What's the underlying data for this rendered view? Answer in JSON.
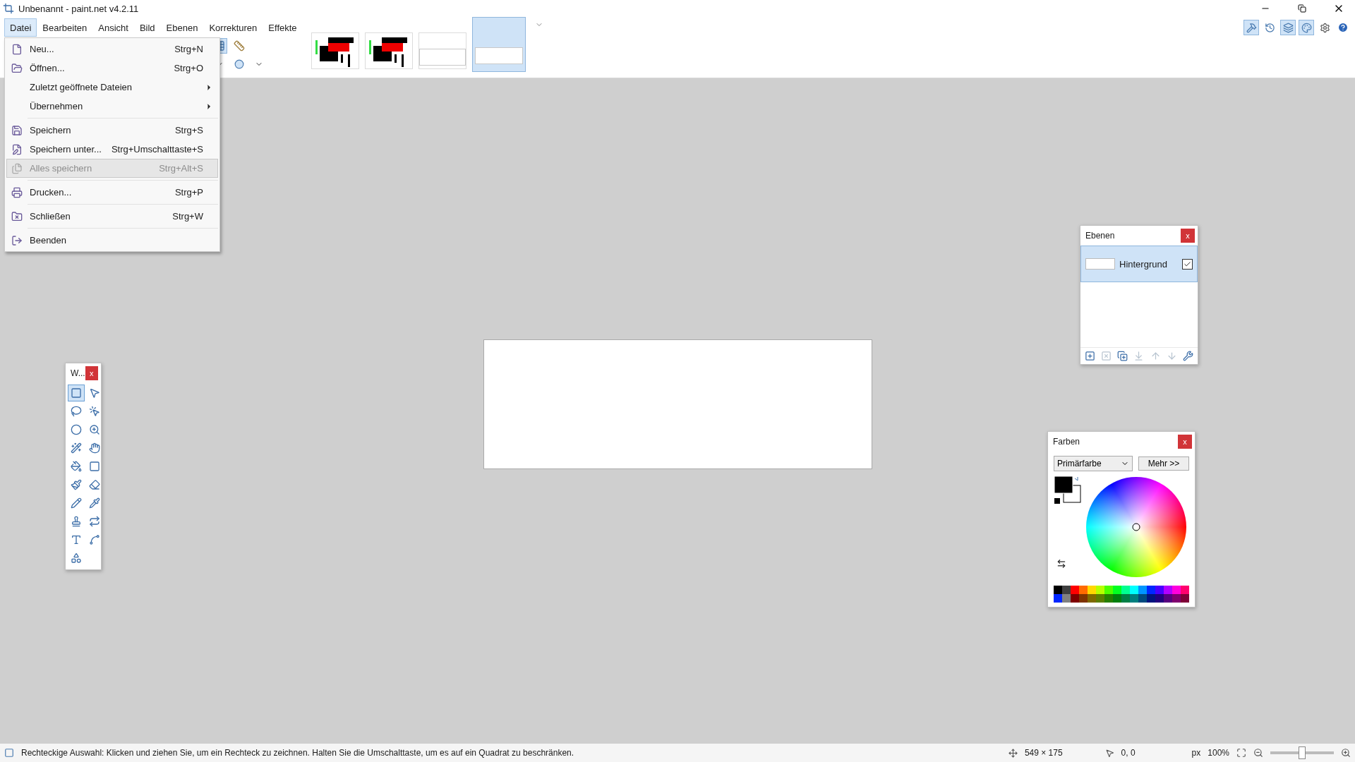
{
  "window": {
    "title": "Unbenannt - paint.net v4.2.11"
  },
  "menu_bar": [
    {
      "label": "Datei",
      "selected": true
    },
    {
      "label": "Bearbeiten",
      "selected": false
    },
    {
      "label": "Ansicht",
      "selected": false
    },
    {
      "label": "Bild",
      "selected": false
    },
    {
      "label": "Ebenen",
      "selected": false
    },
    {
      "label": "Korrekturen",
      "selected": false
    },
    {
      "label": "Effekte",
      "selected": false
    }
  ],
  "image_tabs": [
    {
      "kind": "picture",
      "selected": false
    },
    {
      "kind": "picture",
      "selected": false
    },
    {
      "kind": "blank",
      "selected": false
    },
    {
      "kind": "blank",
      "selected": true
    }
  ],
  "panel_toggles": [
    {
      "selected": true
    },
    {
      "selected": false
    },
    {
      "selected": true
    },
    {
      "selected": true
    }
  ],
  "file_menu": [
    [
      {
        "label": "Neu...",
        "shortcut": "Strg+N",
        "kind": "command",
        "disabled": false,
        "selected": false
      },
      {
        "label": "Öffnen...",
        "shortcut": "Strg+O",
        "kind": "command",
        "disabled": false,
        "selected": false
      },
      {
        "label": "Zuletzt geöffnete Dateien",
        "kind": "submenu",
        "disabled": false,
        "selected": false
      },
      {
        "label": "Übernehmen",
        "kind": "submenu",
        "disabled": false,
        "selected": false
      }
    ],
    [
      {
        "label": "Speichern",
        "shortcut": "Strg+S",
        "kind": "command",
        "disabled": false,
        "selected": false
      },
      {
        "label": "Speichern unter...",
        "shortcut": "Strg+Umschalttaste+S",
        "kind": "command",
        "disabled": false,
        "selected": false
      },
      {
        "label": "Alles speichern",
        "shortcut": "Strg+Alt+S",
        "kind": "command",
        "disabled": true,
        "selected": true
      }
    ],
    [
      {
        "label": "Drucken...",
        "shortcut": "Strg+P",
        "kind": "command",
        "disabled": false,
        "selected": false
      }
    ],
    [
      {
        "label": "Schließen",
        "shortcut": "Strg+W",
        "kind": "command",
        "disabled": false,
        "selected": false
      }
    ],
    [
      {
        "label": "Beenden",
        "kind": "command",
        "disabled": false,
        "selected": false
      }
    ]
  ],
  "tools_window": {
    "title": "W...",
    "close": "x",
    "tools": [
      {
        "selected": true
      },
      {
        "selected": false
      },
      {
        "selected": false
      },
      {
        "selected": false
      },
      {
        "selected": false
      },
      {
        "selected": false
      },
      {
        "selected": false
      },
      {
        "selected": false
      },
      {
        "selected": false
      },
      {
        "selected": false
      },
      {
        "selected": false
      },
      {
        "selected": false
      },
      {
        "selected": false
      },
      {
        "selected": false
      },
      {
        "selected": false
      },
      {
        "selected": false
      },
      {
        "selected": false
      },
      {
        "selected": false
      },
      {
        "selected": false
      }
    ]
  },
  "layers_window": {
    "title": "Ebenen",
    "close": "x",
    "layers": [
      {
        "name": "Hintergrund",
        "visible": true,
        "selected": true
      }
    ],
    "buttons": [
      {
        "disabled": false
      },
      {
        "disabled": true
      },
      {
        "disabled": false
      },
      {
        "disabled": true
      },
      {
        "disabled": true
      },
      {
        "disabled": true
      },
      {
        "disabled": false
      }
    ]
  },
  "colors_window": {
    "title": "Farben",
    "close": "x",
    "target": "Primärfarbe",
    "more_button": "Mehr >>",
    "palette": [
      {
        "color": "#000000"
      },
      {
        "color": "#404040"
      },
      {
        "color": "#ff0000"
      },
      {
        "color": "#ff6a00"
      },
      {
        "color": "#ffd800"
      },
      {
        "color": "#b6ff00"
      },
      {
        "color": "#4cff00"
      },
      {
        "color": "#00ff21"
      },
      {
        "color": "#00ff90"
      },
      {
        "color": "#00ffff"
      },
      {
        "color": "#0094ff"
      },
      {
        "color": "#0026ff"
      },
      {
        "color": "#4800ff"
      },
      {
        "color": "#b200ff"
      },
      {
        "color": "#ff00dc"
      },
      {
        "color": "#ff006e"
      },
      {
        "color": "#0026ff"
      },
      {
        "color": "#808080"
      },
      {
        "color": "#7f0000"
      },
      {
        "color": "#7f3300"
      },
      {
        "color": "#7f6a00"
      },
      {
        "color": "#5b7f00"
      },
      {
        "color": "#267f00"
      },
      {
        "color": "#007f0e"
      },
      {
        "color": "#007f46"
      },
      {
        "color": "#007f7f"
      },
      {
        "color": "#004a7f"
      },
      {
        "color": "#00137f"
      },
      {
        "color": "#21007f"
      },
      {
        "color": "#57007f"
      },
      {
        "color": "#7f006e"
      },
      {
        "color": "#7f0037"
      }
    ]
  },
  "status_bar": {
    "hint": "Rechteckige Auswahl: Klicken und ziehen Sie, um ein Rechteck zu zeichnen. Halten Sie die Umschalttaste, um es auf ein Quadrat zu beschränken.",
    "selection_size": "549 × 175",
    "cursor_position": "0, 0",
    "unit": "px",
    "zoom": "100%",
    "zoom_slider": {
      "level": 0.5
    }
  }
}
